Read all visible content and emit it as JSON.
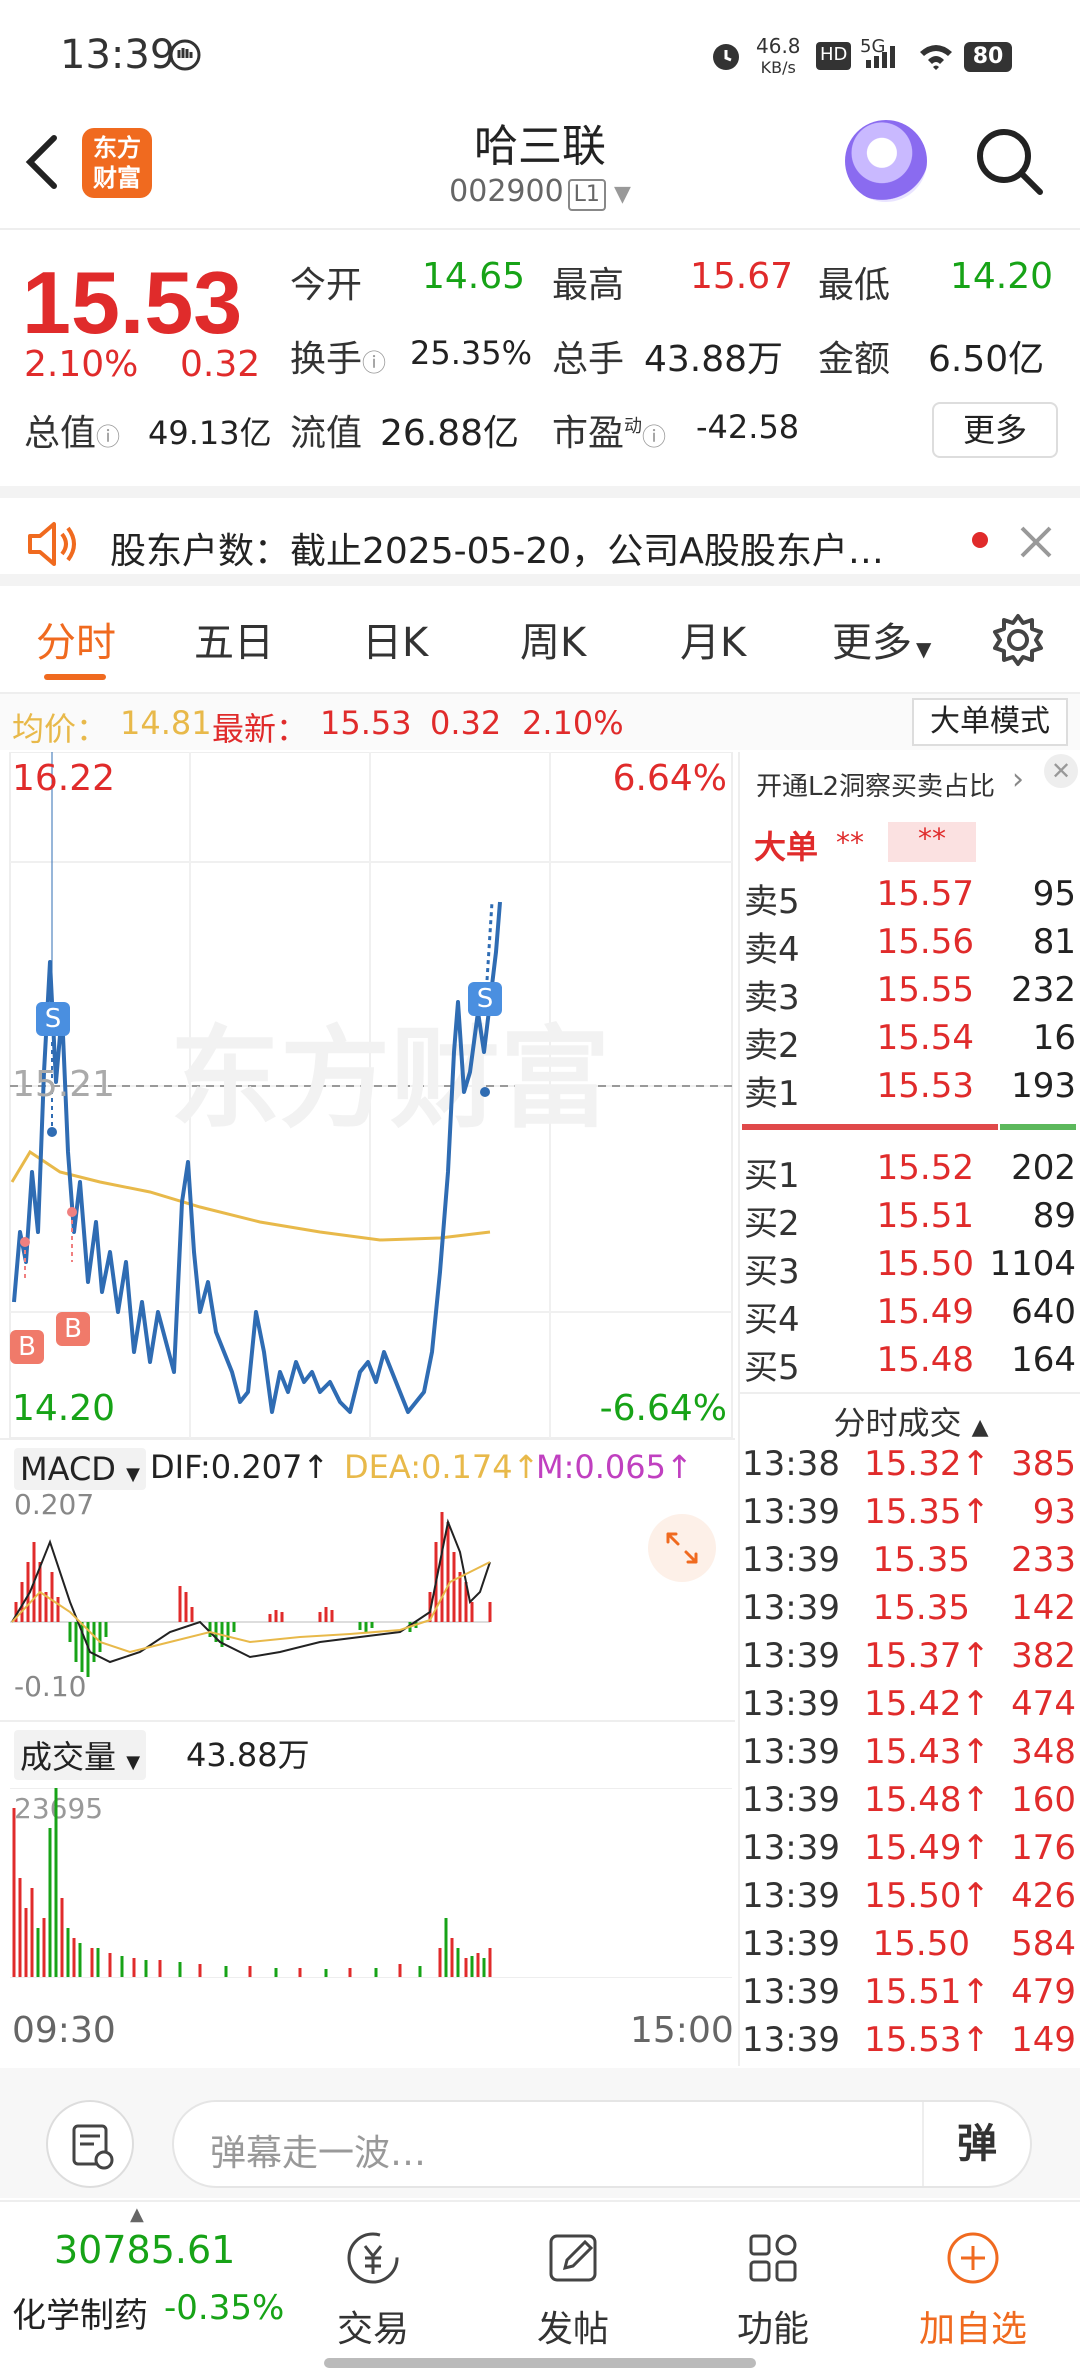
{
  "status": {
    "time": "13:39",
    "net_speed": "46.8",
    "net_unit": "KB/s",
    "hd": "HD",
    "sig": "5G",
    "battery": "80"
  },
  "header": {
    "logo_line1": "东方",
    "logo_line2": "财富",
    "title": "哈三联",
    "code": "002900",
    "level": "L1"
  },
  "quote": {
    "price": "15.53",
    "pct": "2.10%",
    "change": "0.32",
    "open_label": "今开",
    "open": "14.65",
    "high_label": "最高",
    "high": "15.67",
    "low_label": "最低",
    "low": "14.20",
    "turnover_label": "换手",
    "turnover": "25.35%",
    "vol_label": "总手",
    "vol": "43.88万",
    "amount_label": "金额",
    "amount": "6.50亿",
    "mktcap_label": "总值",
    "mktcap": "49.13亿",
    "float_label": "流值",
    "float": "26.88亿",
    "pe_label": "市盈",
    "pe_sup": "动",
    "pe": "-42.58",
    "more": "更多"
  },
  "news": {
    "text": "股东户数：截止2025-05-20，公司A股股东户…"
  },
  "tabs": [
    "分时",
    "五日",
    "日K",
    "周K",
    "月K",
    "更多"
  ],
  "info": {
    "avg_label": "均价：",
    "avg": "14.81",
    "latest_label": "最新：",
    "latest": "15.53",
    "chg": "0.32",
    "pct": "2.10%",
    "mode": "大单模式"
  },
  "chart": {
    "y_top": "16.22",
    "y_top_pct": "6.64%",
    "y_mid": "15.21",
    "y_bot": "14.20",
    "y_bot_pct": "-6.64%",
    "watermark": "东方财富",
    "time_start": "09:30",
    "time_end": "15:00",
    "markers": [
      "S",
      "S",
      "B",
      "B"
    ]
  },
  "macd": {
    "name": "MACD",
    "dif": "DIF:0.207",
    "dea": "DEA:0.174",
    "m": "M:0.065",
    "top": "0.207",
    "bot": "-0.10"
  },
  "volume": {
    "name": "成交量",
    "total": "43.88万",
    "max": "23695"
  },
  "orderbook": {
    "promo": "开通L2洞察买卖占比",
    "big_label": "大单",
    "big_v1": "**",
    "big_v2": "**",
    "asks": [
      {
        "label": "卖5",
        "price": "15.57",
        "qty": "95"
      },
      {
        "label": "卖4",
        "price": "15.56",
        "qty": "81"
      },
      {
        "label": "卖3",
        "price": "15.55",
        "qty": "232"
      },
      {
        "label": "卖2",
        "price": "15.54",
        "qty": "16"
      },
      {
        "label": "卖1",
        "price": "15.53",
        "qty": "193"
      }
    ],
    "bids": [
      {
        "label": "买1",
        "price": "15.52",
        "qty": "202"
      },
      {
        "label": "买2",
        "price": "15.51",
        "qty": "89"
      },
      {
        "label": "买3",
        "price": "15.50",
        "qty": "1104"
      },
      {
        "label": "买4",
        "price": "15.49",
        "qty": "640"
      },
      {
        "label": "买5",
        "price": "15.48",
        "qty": "164"
      }
    ],
    "trades_label": "分时成交",
    "trades": [
      {
        "t": "13:38",
        "p": "15.32↑",
        "q": "385"
      },
      {
        "t": "13:39",
        "p": "15.35↑",
        "q": "93"
      },
      {
        "t": "13:39",
        "p": "15.35",
        "q": "233"
      },
      {
        "t": "13:39",
        "p": "15.35",
        "q": "142"
      },
      {
        "t": "13:39",
        "p": "15.37↑",
        "q": "382"
      },
      {
        "t": "13:39",
        "p": "15.42↑",
        "q": "474"
      },
      {
        "t": "13:39",
        "p": "15.43↑",
        "q": "348"
      },
      {
        "t": "13:39",
        "p": "15.48↑",
        "q": "160"
      },
      {
        "t": "13:39",
        "p": "15.49↑",
        "q": "176"
      },
      {
        "t": "13:39",
        "p": "15.50↑",
        "q": "426"
      },
      {
        "t": "13:39",
        "p": "15.50",
        "q": "584"
      },
      {
        "t": "13:39",
        "p": "15.51↑",
        "q": "479"
      },
      {
        "t": "13:39",
        "p": "15.53↑",
        "q": "149"
      }
    ]
  },
  "comment": {
    "placeholder": "弹幕走一波…",
    "dan": "弹"
  },
  "bottom": {
    "index_value": "30785.61",
    "index_name": "化学制药",
    "index_pct": "-0.35%",
    "items": [
      {
        "label": "交易"
      },
      {
        "label": "发帖"
      },
      {
        "label": "功能"
      },
      {
        "label": "加自选"
      }
    ]
  },
  "colors": {
    "up": "#e02b2b",
    "down": "#17a317",
    "accent": "#f06a1f",
    "line": "#2f6cb3",
    "avg": "#e8b94a"
  }
}
